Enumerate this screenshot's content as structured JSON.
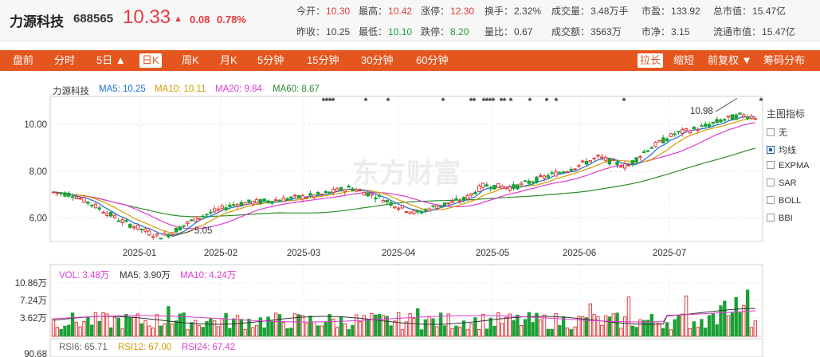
{
  "stock": {
    "name": "力源科技",
    "code": "688565",
    "price": "10.33",
    "arrow": "▲",
    "change": "0.08",
    "change_pct": "0.78%"
  },
  "quote": {
    "row1": [
      {
        "label": "今开：",
        "value": "10.30",
        "color": "red"
      },
      {
        "label": "最高：",
        "value": "10.42",
        "color": "red"
      },
      {
        "label": "涨停：",
        "value": "12.30",
        "color": "red"
      },
      {
        "label": "换手：",
        "value": "2.32%",
        "color": ""
      },
      {
        "label": "成交量：",
        "value": "3.48万手",
        "color": ""
      },
      {
        "label": "市盈：",
        "value": "133.92",
        "color": ""
      },
      {
        "label": "总市值：",
        "value": "15.47亿",
        "color": ""
      }
    ],
    "row2": [
      {
        "label": "昨收：",
        "value": "10.25",
        "color": ""
      },
      {
        "label": "最低：",
        "value": "10.10",
        "color": "green"
      },
      {
        "label": "跌停：",
        "value": "8.20",
        "color": "green"
      },
      {
        "label": "量比：",
        "value": "0.67",
        "color": ""
      },
      {
        "label": "成交额：",
        "value": "3563万",
        "color": ""
      },
      {
        "label": "市净：",
        "value": "3.15",
        "color": ""
      },
      {
        "label": "流通市值：",
        "value": "15.47亿",
        "color": ""
      }
    ]
  },
  "toolbar": {
    "left": [
      "盘前",
      "分时",
      "5日 ▲",
      "日K",
      "周K",
      "月K",
      "5分钟",
      "15分钟",
      "30分钟",
      "60分钟"
    ],
    "active_index": 3,
    "right": [
      "拉长",
      "缩短",
      "前复权 ▼",
      "筹码分布"
    ],
    "right_active_index": 0
  },
  "legend": {
    "name": "力源科技",
    "ma5": "MA5: 10.25",
    "ma10": "MA10: 10.11",
    "ma20": "MA20: 9.84",
    "ma60": "MA60: 8.67",
    "vol": "VOL: 3.48万",
    "vol_ma5": "MA5: 3.90万",
    "vol_ma10": "MA10: 4.24万",
    "rsi6": "RSI6: 65.71",
    "rsi12": "RSI12: 67.00",
    "rsi24": "RSI24: 67.42"
  },
  "colors": {
    "up": "#e4393c",
    "down": "#1aa034",
    "ma5": "#1f6fd2",
    "ma10": "#d59a00",
    "ma20": "#e03ad1",
    "ma60": "#2e8b2e",
    "accent": "#e5561f"
  },
  "indicators": {
    "title": "主图指标",
    "options": [
      "无",
      "均线",
      "EXPMA",
      "SAR",
      "BOLL",
      "BBI"
    ],
    "checked_index": 1
  },
  "watermark": "东方财富",
  "chart_data": {
    "type": "candlestick",
    "price_ylim": [
      5.0,
      11.2
    ],
    "price_ticks": [
      "10.00",
      "8.00",
      "6.00"
    ],
    "date_ticks": [
      "2025-01",
      "2025-02",
      "2025-03",
      "2025-04",
      "2025-05",
      "2025-06",
      "2025-07"
    ],
    "volume_ticks": [
      "10.86万",
      "7.24万",
      "3.62万"
    ],
    "rsi_tick": "90.68",
    "annotations": {
      "high": "10.98",
      "low": "5.05"
    }
  }
}
